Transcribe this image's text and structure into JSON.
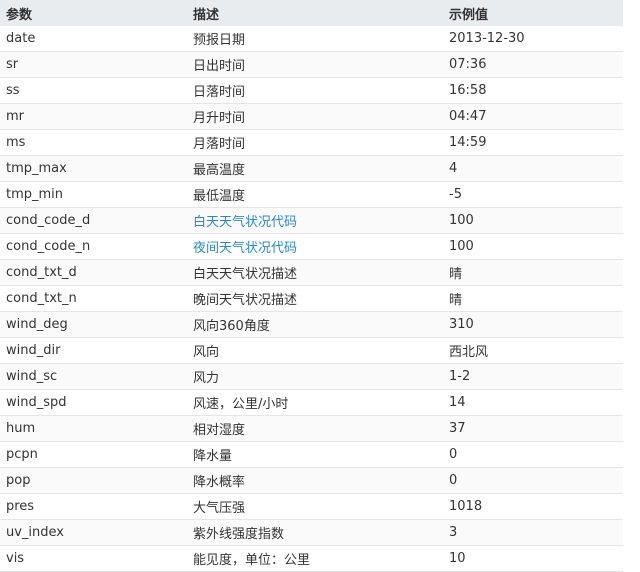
{
  "header": {
    "param": "参数",
    "description": "描述",
    "example": "示例值"
  },
  "rows": [
    {
      "param": "date",
      "description": "预报日期",
      "example": "2013-12-30",
      "link": false
    },
    {
      "param": "sr",
      "description": "日出时间",
      "example": "07:36",
      "link": false
    },
    {
      "param": "ss",
      "description": "日落时间",
      "example": "16:58",
      "link": false
    },
    {
      "param": "mr",
      "description": "月升时间",
      "example": "04:47",
      "link": false
    },
    {
      "param": "ms",
      "description": "月落时间",
      "example": "14:59",
      "link": false
    },
    {
      "param": "tmp_max",
      "description": "最高温度",
      "example": "4",
      "link": false
    },
    {
      "param": "tmp_min",
      "description": "最低温度",
      "example": "-5",
      "link": false
    },
    {
      "param": "cond_code_d",
      "description": "白天天气状况代码",
      "example": "100",
      "link": true
    },
    {
      "param": "cond_code_n",
      "description": "夜间天气状况代码",
      "example": "100",
      "link": true
    },
    {
      "param": "cond_txt_d",
      "description": "白天天气状况描述",
      "example": "晴",
      "link": false
    },
    {
      "param": "cond_txt_n",
      "description": "晚间天气状况描述",
      "example": "晴",
      "link": false
    },
    {
      "param": "wind_deg",
      "description": "风向360角度",
      "example": "310",
      "link": false
    },
    {
      "param": "wind_dir",
      "description": "风向",
      "example": "西北风",
      "link": false
    },
    {
      "param": "wind_sc",
      "description": "风力",
      "example": "1-2",
      "link": false
    },
    {
      "param": "wind_spd",
      "description": "风速，公里/小时",
      "example": "14",
      "link": false
    },
    {
      "param": "hum",
      "description": "相对湿度",
      "example": "37",
      "link": false
    },
    {
      "param": "pcpn",
      "description": "降水量",
      "example": "0",
      "link": false
    },
    {
      "param": "pop",
      "description": "降水概率",
      "example": "0",
      "link": false
    },
    {
      "param": "pres",
      "description": "大气压强",
      "example": "1018",
      "link": false
    },
    {
      "param": "uv_index",
      "description": "紫外线强度指数",
      "example": "3",
      "link": false
    },
    {
      "param": "vis",
      "description": "能见度，单位：公里",
      "example": "10",
      "link": false
    }
  ],
  "colors": {
    "header_bg": "#e9ecef",
    "link": "#2a86d4",
    "row_border": "#e5e5e5",
    "text": "#333333"
  }
}
